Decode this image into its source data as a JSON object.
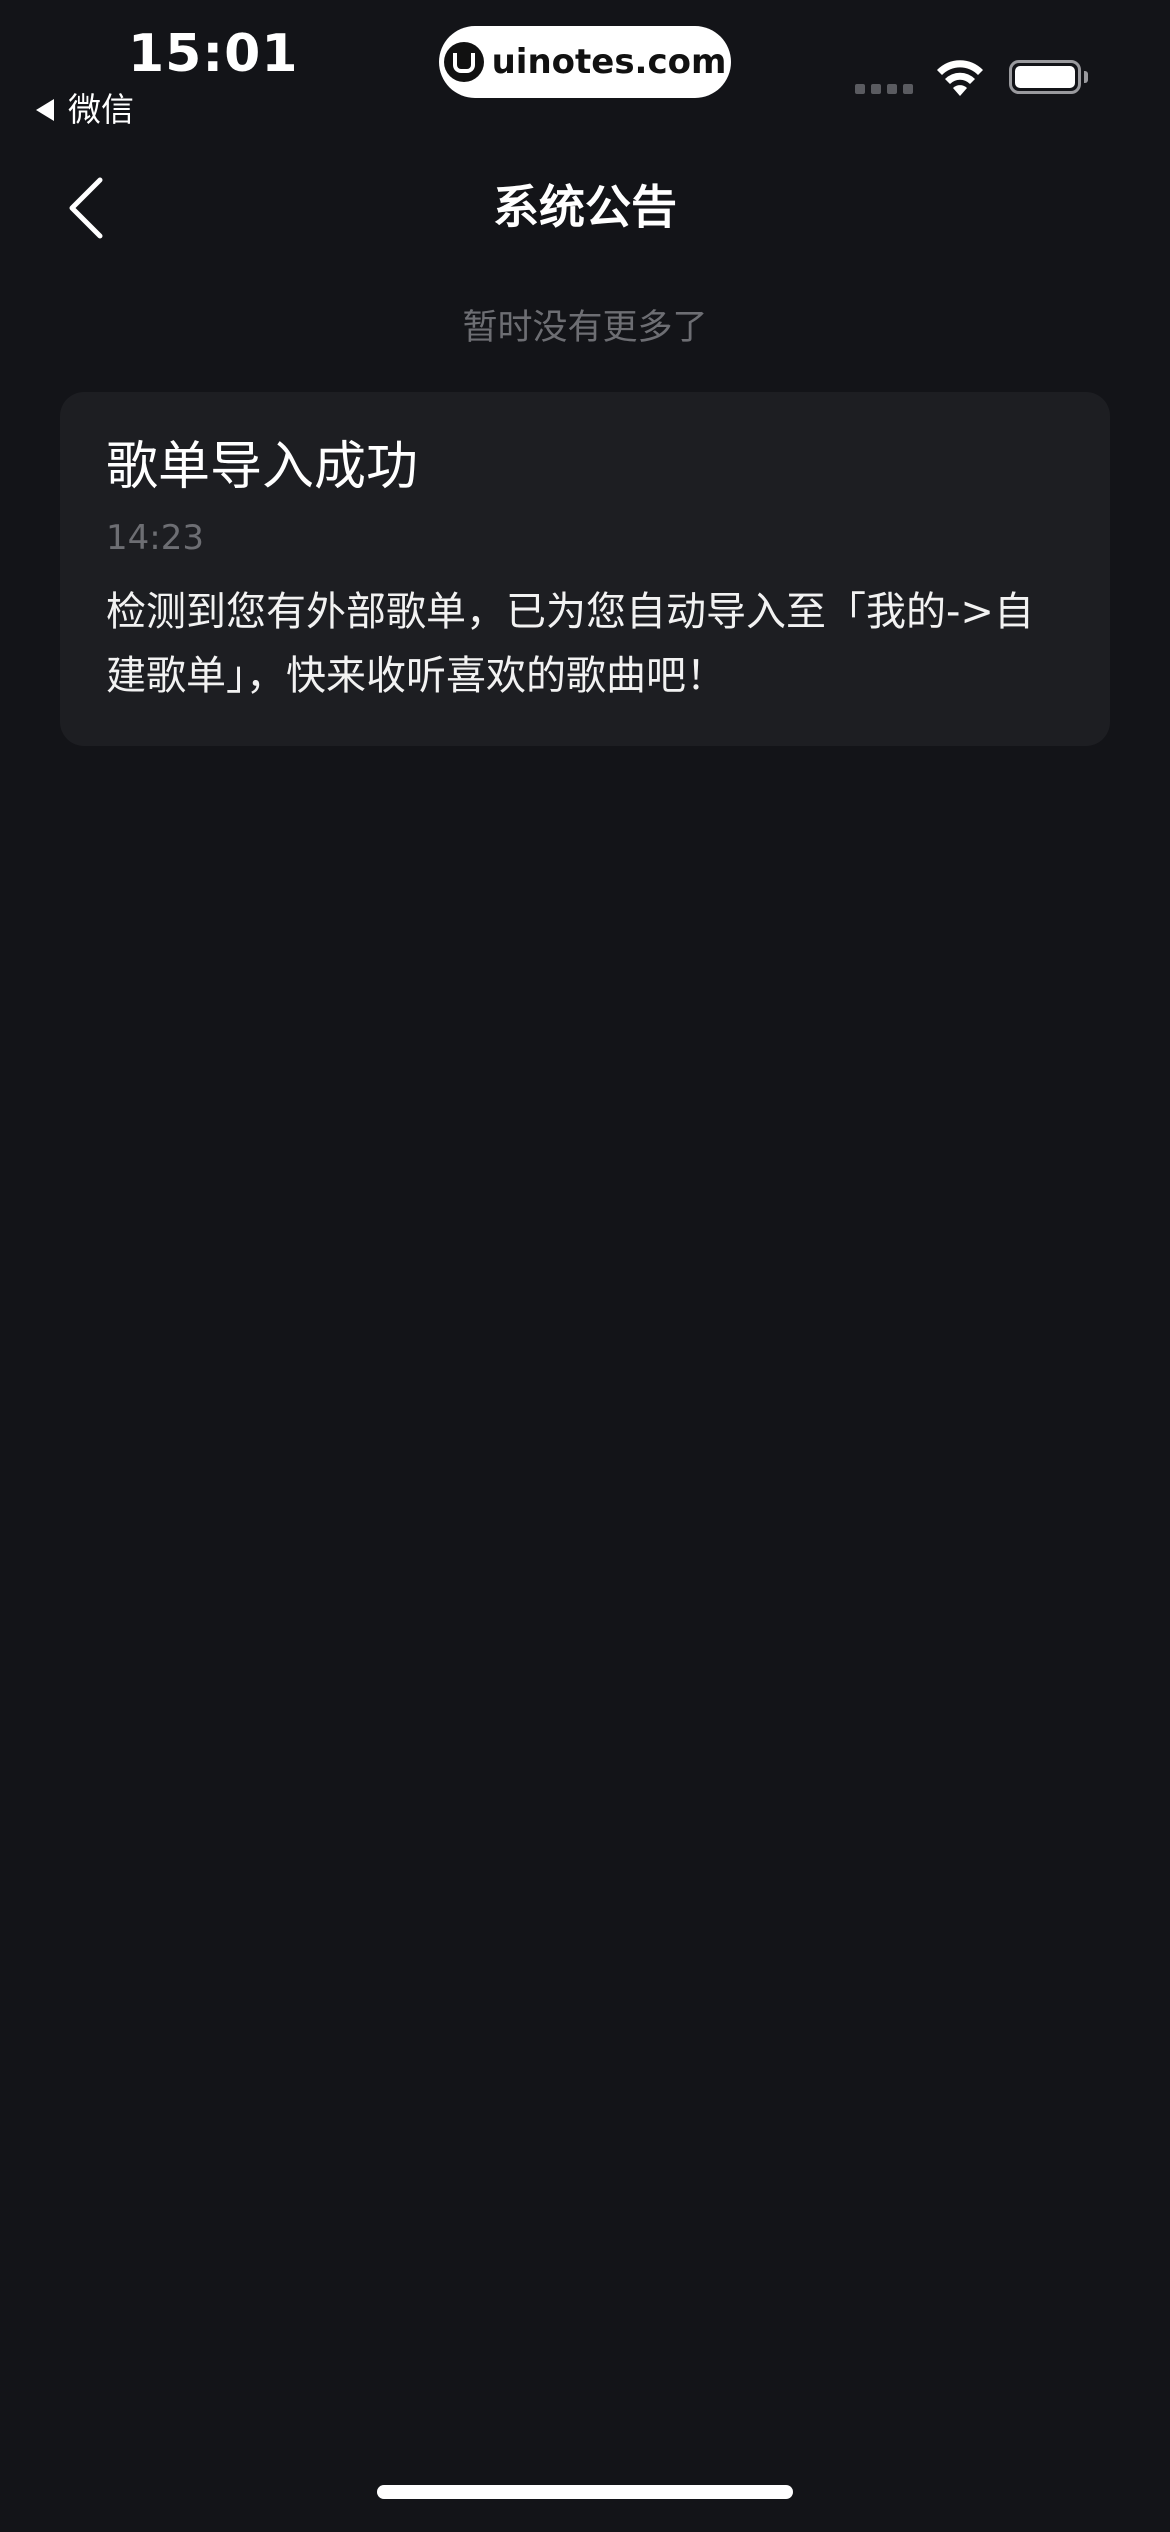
{
  "status_bar": {
    "time": "15:01",
    "back_app_label": "微信",
    "watermark": "uinotes.com",
    "battery_level": 1.0
  },
  "nav": {
    "title": "系统公告",
    "back_icon": "chevron-left-icon"
  },
  "list": {
    "no_more_text": "暂时没有更多了",
    "announcements": [
      {
        "title": "歌单导入成功",
        "time": "14:23",
        "body": "检测到您有外部歌单，已为您自动导入至「我的->自建歌单」，快来收听喜欢的歌曲吧！"
      }
    ]
  },
  "colors": {
    "background": "#131418",
    "card": "#1d1e22",
    "muted_text": "#6d6e73",
    "primary_text": "#ffffff"
  }
}
